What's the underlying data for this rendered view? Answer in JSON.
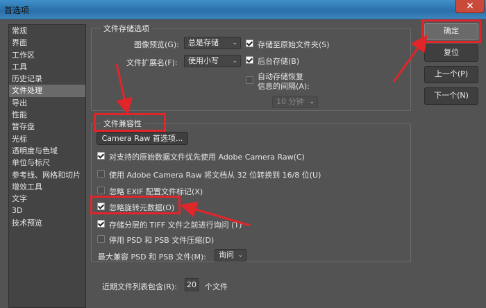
{
  "window": {
    "title": "首选项",
    "close_label": "✕"
  },
  "nav": {
    "items": [
      "常规",
      "界面",
      "工作区",
      "工具",
      "历史记录",
      "文件处理",
      "导出",
      "性能",
      "暂存盘",
      "光标",
      "透明度与色域",
      "单位与标尺",
      "参考线、网格和切片",
      "增效工具",
      "文字",
      "3D",
      "技术预览"
    ],
    "selected_index": 5
  },
  "file_saving": {
    "legend": "文件存储选项",
    "image_preview_label": "图像预览(G):",
    "image_preview_value": "总是存储",
    "extension_label": "文件扩展名(F):",
    "extension_value": "使用小写",
    "save_as_original_label": "存储至原始文件夹(S)",
    "save_as_original_checked": true,
    "background_save_label": "后台存储(B)",
    "background_save_checked": true,
    "auto_recovery_label_1": "自动存储恢复",
    "auto_recovery_label_2": "信息的间隔(A):",
    "auto_recovery_checked": false,
    "interval_value": "10 分钟"
  },
  "compat": {
    "legend": "文件兼容性",
    "camera_raw_button": "Camera Raw 首选项...",
    "options": [
      {
        "label": "对支持的原始数据文件优先使用 Adobe Camera Raw(C)",
        "checked": true
      },
      {
        "label": "使用 Adobe Camera Raw 将文档从 32 位转换到 16/8 位(U)",
        "checked": false
      },
      {
        "label": "忽略 EXIF 配置文件标记(X)",
        "checked": false
      },
      {
        "label": "忽略旋转元数据(O)",
        "checked": true
      },
      {
        "label": "存储分层的 TIFF 文件之前进行询问 (T)",
        "checked": true
      },
      {
        "label": "停用 PSD 和 PSB 文件压缩(D)",
        "checked": false
      }
    ],
    "max_compat_label": "最大兼容 PSD 和 PSB 文件(M):",
    "max_compat_value": "询问"
  },
  "recent": {
    "label": "近期文件列表包含(R):",
    "value": "20",
    "suffix": "个文件"
  },
  "buttons": {
    "ok": "确定",
    "reset": "复位",
    "prev": "上一个(P)",
    "next": "下一个(N)"
  },
  "colors": {
    "annotation_red": "#e0262a",
    "titlebar_blue": "#2a6fa9"
  }
}
